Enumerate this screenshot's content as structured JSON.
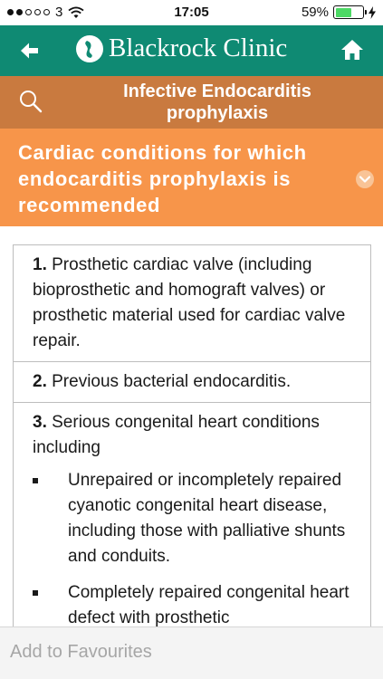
{
  "status_bar": {
    "carrier": "3",
    "time": "17:05",
    "battery_percent": "59%",
    "battery_level": 0.59,
    "signal_bars_filled": 2,
    "signal_bars_total": 5
  },
  "header": {
    "title": "Blackrock Clinic",
    "back_icon": "left-arrow-icon",
    "home_icon": "home-icon",
    "logo_icon": "clinic-logo-icon"
  },
  "title_bar": {
    "title": "Infective Endocarditis prophylaxis",
    "search_icon": "search-icon"
  },
  "section": {
    "title": "Cardiac conditions for which endocarditis prophylaxis is recommended",
    "chevron_icon": "chevron-down-icon"
  },
  "items": [
    {
      "number": "1.",
      "text": " Prosthetic cardiac valve (including bioprosthetic and homograft valves) or prosthetic material used for cardiac valve repair."
    },
    {
      "number": "2.",
      "text": " Previous bacterial endocarditis."
    },
    {
      "number": "3.",
      "text": " Serious congenital heart conditions including",
      "bullets": [
        "Unrepaired or incompletely repaired cyanotic congenital heart disease, including those with palliative shunts and conduits.",
        "Completely repaired congenital heart defect with prosthetic"
      ]
    }
  ],
  "footer": {
    "favourites_label": "Add to Favourites"
  },
  "colors": {
    "header": "#0f8a73",
    "title_bar": "#c97a3f",
    "section_header": "#f7954a",
    "battery": "#4cd964"
  }
}
